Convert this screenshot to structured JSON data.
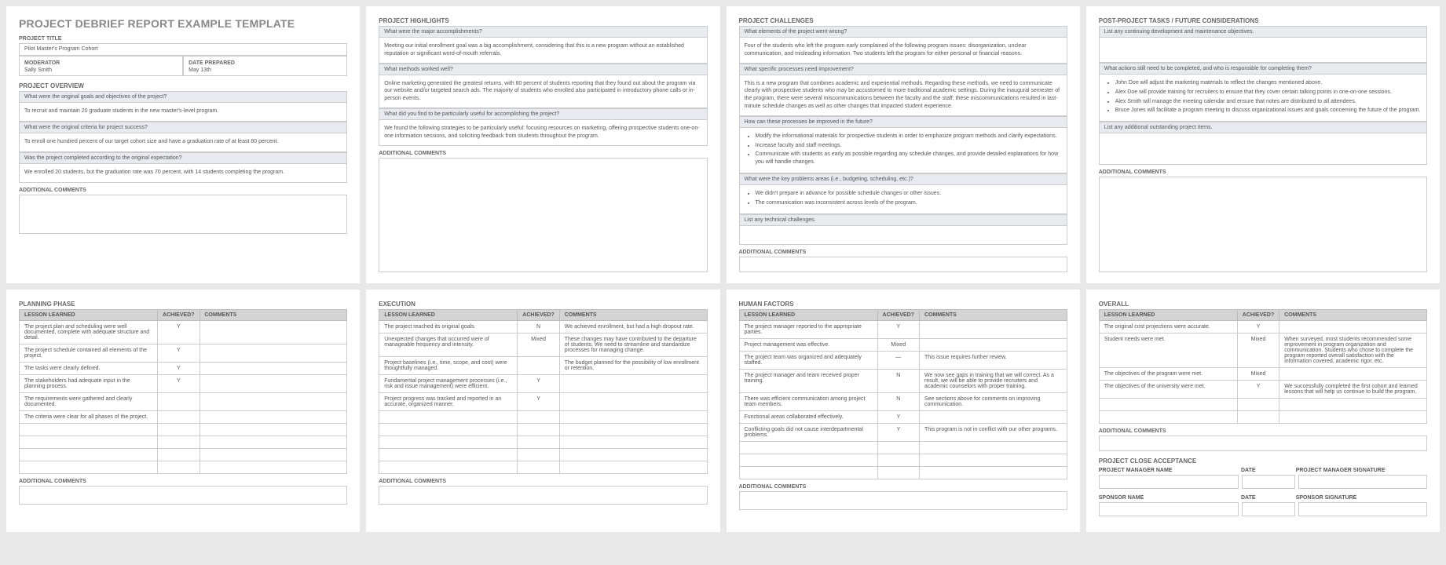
{
  "page1": {
    "title": "PROJECT DEBRIEF REPORT EXAMPLE TEMPLATE",
    "project_title_label": "PROJECT TITLE",
    "project_title": "Pilot Master's Program Cohort",
    "moderator_label": "MODERATOR",
    "moderator": "Sally Smith",
    "date_label": "DATE PREPARED",
    "date": "May 13th",
    "overview_header": "PROJECT OVERVIEW",
    "q1": "What were the original goals and objectives of the project?",
    "a1": "To recruit and maintain 20 graduate students in the new master's-level program.",
    "q2": "What were the original criteria for project success?",
    "a2": "To enroll one hundred percent of our target cohort size and have a graduation rate of at least 80 percent.",
    "q3": "Was the project completed according to the original expectation?",
    "a3": "We enrolled 20 students, but the graduation rate was 70 percent, with 14 students completing the program.",
    "comments_label": "Additional Comments"
  },
  "page2": {
    "header": "PROJECT HIGHLIGHTS",
    "q1": "What were the major accomplishments?",
    "a1": "Meeting our initial enrollment goal was a big accomplishment, considering that this is a new program without an established reputation or significant word-of-mouth referrals.",
    "q2": "What methods worked well?",
    "a2": "Online marketing generated the greatest returns, with 80 percent of students reporting that they found out about the program via our website and/or targeted search ads. The majority of students who enrolled also participated in introductory phone calls or in-person events.",
    "q3": "What did you find to be particularly useful for accomplishing the project?",
    "a3": "We found the following strategies to be particularly useful: focusing resources on marketing, offering prospective students one-on-one information sessions, and soliciting feedback from students throughout the program.",
    "comments_label": "Additional Comments"
  },
  "page3": {
    "header": "PROJECT CHALLENGES",
    "q1": "What elements of the project went wrong?",
    "a1": "Four of the students who left the program early complained of the following program issues: disorganization, unclear communication, and misleading information. Two students left the program for either personal or financial reasons.",
    "q2": "What specific processes need improvement?",
    "a2": "This is a new program that combines academic and experiential methods. Regarding these methods, we need to communicate clearly with prospective students who may be accustomed to more traditional academic settings. During the inaugural semester of the program, there were several miscommunications between the faculty and the staff; these miscommunications resulted in last-minute schedule changes as well as other changes that impacted student experience.",
    "q3": "How can these processes be improved in the future?",
    "a3_items": [
      "Modify the informational materials for prospective students in order to emphasize program methods and clarify expectations.",
      "Increase faculty and staff meetings.",
      "Communicate with students as early as possible regarding any schedule changes, and provide detailed explanations for how you will handle changes."
    ],
    "q4": "What were the key problems areas (i.e., budgeting, scheduling, etc.)?",
    "a4_items": [
      "We didn't prepare in advance for possible schedule changes or other issues.",
      "The communication was inconsistent across levels of the program."
    ],
    "q5": "List any technical challenges.",
    "comments_label": "Additional Comments"
  },
  "page4": {
    "header": "POST-PROJECT TASKS / FUTURE CONSIDERATIONS",
    "q1": "List any continuing development and maintenance objectives.",
    "q2": "What actions still need to be completed, and who is responsible for completing them?",
    "a2_items": [
      "John Doe will adjust the marketing materials to reflect the changes mentioned above.",
      "Alex Doe will provide training for recruiters to ensure that they cover certain talking points in one-on-one sessions.",
      "Alex Smith will manage the meeting calendar and ensure that notes are distributed to all attendees.",
      "Bruce Jones will facilitate a program meeting to discuss organizational issues and goals concerning the future of the program."
    ],
    "q3": "List any additional outstanding project items.",
    "comments_label": "Additional Comments"
  },
  "page5": {
    "header": "PLANNING PHASE",
    "cols": {
      "lesson": "LESSON LEARNED",
      "achieved": "ACHIEVED?",
      "comments": "COMMENTS"
    },
    "rows": [
      {
        "lesson": "The project plan and scheduling were well documented, complete with adequate structure and detail.",
        "achieved": "Y",
        "comments": ""
      },
      {
        "lesson": "The project schedule contained all elements of the project.",
        "achieved": "Y",
        "comments": ""
      },
      {
        "lesson": "The tasks were clearly defined.",
        "achieved": "Y",
        "comments": ""
      },
      {
        "lesson": "The stakeholders had adequate input in the planning process.",
        "achieved": "Y",
        "comments": ""
      },
      {
        "lesson": "The requirements were gathered and clearly documented.",
        "achieved": "",
        "comments": ""
      },
      {
        "lesson": "The criteria were clear for all phases of the project.",
        "achieved": "",
        "comments": ""
      }
    ],
    "comments_label": "Additional Comments"
  },
  "page6": {
    "header": "EXECUTION",
    "cols": {
      "lesson": "LESSON LEARNED",
      "achieved": "ACHIEVED?",
      "comments": "COMMENTS"
    },
    "rows": [
      {
        "lesson": "The project reached its original goals.",
        "achieved": "N",
        "comments": "We achieved enrollment, but had a high dropout rate."
      },
      {
        "lesson": "Unexpected changes that occurred were of manageable frequency and intensity.",
        "achieved": "Mixed",
        "comments": "These changes may have contributed to the departure of students. We need to streamline and standardize processes for managing change."
      },
      {
        "lesson": "Project baselines (i.e., time, scope, and cost) were thoughtfully managed.",
        "achieved": "",
        "comments": "The budget planned for the possibility of low enrollment or retention."
      },
      {
        "lesson": "Fundamental project management processes (i.e., risk and issue management) were efficient.",
        "achieved": "Y",
        "comments": ""
      },
      {
        "lesson": "Project progress was tracked and reported in an accurate, organized manner.",
        "achieved": "Y",
        "comments": ""
      }
    ],
    "comments_label": "Additional Comments"
  },
  "page7": {
    "header": "HUMAN FACTORS",
    "cols": {
      "lesson": "LESSON LEARNED",
      "achieved": "ACHIEVED?",
      "comments": "COMMENTS"
    },
    "rows": [
      {
        "lesson": "The project manager reported to the appropriate parties.",
        "achieved": "Y",
        "comments": ""
      },
      {
        "lesson": "Project management was effective.",
        "achieved": "Mixed",
        "comments": ""
      },
      {
        "lesson": "The project team was organized and adequately staffed.",
        "achieved": "—",
        "comments": "This issue requires further review."
      },
      {
        "lesson": "The project manager and team received proper training.",
        "achieved": "N",
        "comments": "We now see gaps in training that we will correct. As a result, we will be able to provide recruiters and academic counselors with proper training."
      },
      {
        "lesson": "There was efficient communication among project team members.",
        "achieved": "N",
        "comments": "See sections above for comments on improving communication."
      },
      {
        "lesson": "Functional areas collaborated effectively.",
        "achieved": "Y",
        "comments": ""
      },
      {
        "lesson": "Conflicting goals did not cause interdepartmental problems.",
        "achieved": "Y",
        "comments": "This program is not in conflict with our other programs."
      }
    ],
    "comments_label": "Additional Comments"
  },
  "page8": {
    "header": "OVERALL",
    "cols": {
      "lesson": "LESSON LEARNED",
      "achieved": "ACHIEVED?",
      "comments": "COMMENTS"
    },
    "rows": [
      {
        "lesson": "The original cost projections were accurate.",
        "achieved": "Y",
        "comments": ""
      },
      {
        "lesson": "Student needs were met.",
        "achieved": "Mixed",
        "comments": "When surveyed, most students recommended some improvement in program organization and communication. Students who chose to complete the program reported overall satisfaction with the information covered, academic rigor, etc."
      },
      {
        "lesson": "The objectives of the program were met.",
        "achieved": "Mixed",
        "comments": ""
      },
      {
        "lesson": "The objectives of the university were met.",
        "achieved": "Y",
        "comments": "We successfully completed the first cohort and learned lessons that will help us continue to build the program."
      }
    ],
    "comments_label": "Additional Comments",
    "close_header": "PROJECT CLOSE ACCEPTANCE",
    "pm_name_label": "PROJECT MANAGER NAME",
    "date_label": "DATE",
    "pm_sig_label": "PROJECT MANAGER SIGNATURE",
    "sponsor_name_label": "SPONSOR NAME",
    "sponsor_sig_label": "SPONSOR SIGNATURE"
  }
}
